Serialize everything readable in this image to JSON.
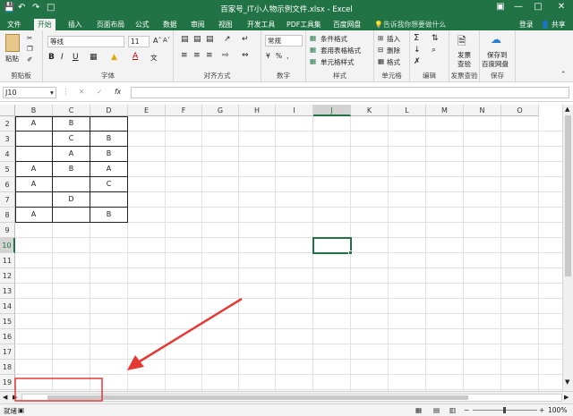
{
  "titlebar": {
    "title": "百家号_IT小人物示例文件.xlsx - Excel"
  },
  "tabs": {
    "file": "文件",
    "home": "开始",
    "insert": "插入",
    "layout": "页面布局",
    "formula": "公式",
    "data": "数据",
    "review": "审阅",
    "view": "视图",
    "dev": "开发工具",
    "pdf": "PDF工具集",
    "baidu": "百度网盘",
    "tellme": "告诉我你想要做什么",
    "login": "登录",
    "share": "共享"
  },
  "ribbon": {
    "paste": "粘贴",
    "clipboard": "剪贴板",
    "font_name": "等线",
    "font_size": "11",
    "bold": "B",
    "italic": "I",
    "underline": "U",
    "font": "字体",
    "align": "对齐方式",
    "numfmt": "常规",
    "number": "数字",
    "cond": "条件格式",
    "table": "套用表格格式",
    "cellstyle": "单元格样式",
    "styles": "样式",
    "insert": "插入",
    "delete": "删除",
    "format": "格式",
    "cells": "单元格",
    "editing": "编辑",
    "invoice_a": "发票",
    "invoice_b": "查验",
    "invoice_grp": "发票查验",
    "save_a": "保存到",
    "save_b": "百度网盘",
    "save_grp": "保存"
  },
  "formula": {
    "namebox": "J10",
    "fx": "fx"
  },
  "grid": {
    "columns": [
      "B",
      "C",
      "D",
      "E",
      "F",
      "G",
      "H",
      "I",
      "J",
      "K",
      "L",
      "M",
      "N",
      "O"
    ],
    "rows": [
      "2",
      "3",
      "4",
      "5",
      "6",
      "7",
      "8",
      "9",
      "10",
      "11",
      "12",
      "13",
      "14",
      "15",
      "16",
      "17",
      "18",
      "19"
    ],
    "cells": [
      [
        "A",
        "B",
        ""
      ],
      [
        "",
        "C",
        "B"
      ],
      [
        "",
        "A",
        "B"
      ],
      [
        "A",
        "B",
        "A"
      ],
      [
        "A",
        "",
        "C"
      ],
      [
        "",
        "D",
        ""
      ],
      [
        "A",
        "",
        "B"
      ]
    ]
  },
  "status": {
    "ready": "就绪",
    "zoom": "100%"
  },
  "colors": {
    "excel_green": "#217346",
    "annotation_red": "#e53935"
  }
}
